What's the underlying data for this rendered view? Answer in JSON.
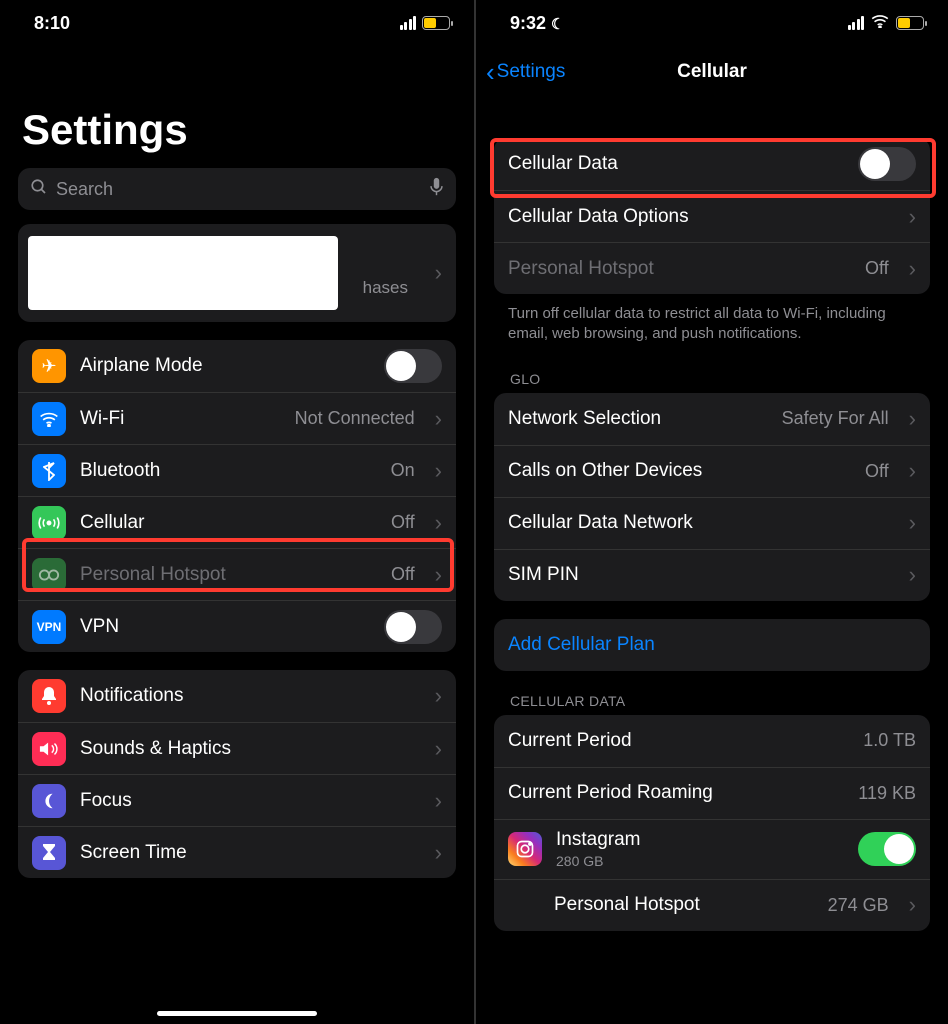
{
  "left": {
    "time": "8:10",
    "title": "Settings",
    "search_placeholder": "Search",
    "profile_tail": "hases",
    "rows": {
      "airplane": "Airplane Mode",
      "wifi": "Wi-Fi",
      "wifi_val": "Not Connected",
      "bluetooth": "Bluetooth",
      "bluetooth_val": "On",
      "cellular": "Cellular",
      "cellular_val": "Off",
      "hotspot": "Personal Hotspot",
      "hotspot_val": "Off",
      "vpn": "VPN",
      "notifications": "Notifications",
      "sounds": "Sounds & Haptics",
      "focus": "Focus",
      "screentime": "Screen Time"
    }
  },
  "right": {
    "time": "9:32",
    "back": "Settings",
    "title": "Cellular",
    "rows": {
      "cell_data": "Cellular Data",
      "cell_opts": "Cellular Data Options",
      "hotspot": "Personal Hotspot",
      "hotspot_val": "Off",
      "footer1": "Turn off cellular data to restrict all data to Wi-Fi, including email, web browsing, and push notifications.",
      "hdr_glo": "GLO",
      "netsel": "Network Selection",
      "netsel_val": "Safety For All",
      "calls": "Calls on Other Devices",
      "calls_val": "Off",
      "cdn": "Cellular Data Network",
      "simpin": "SIM PIN",
      "addplan": "Add Cellular Plan",
      "hdr_cd": "CELLULAR DATA",
      "cur": "Current Period",
      "cur_val": "1.0 TB",
      "roam": "Current Period Roaming",
      "roam_val": "119 KB",
      "insta": "Instagram",
      "insta_sub": "280 GB",
      "ph": "Personal Hotspot",
      "ph_val": "274 GB"
    }
  }
}
